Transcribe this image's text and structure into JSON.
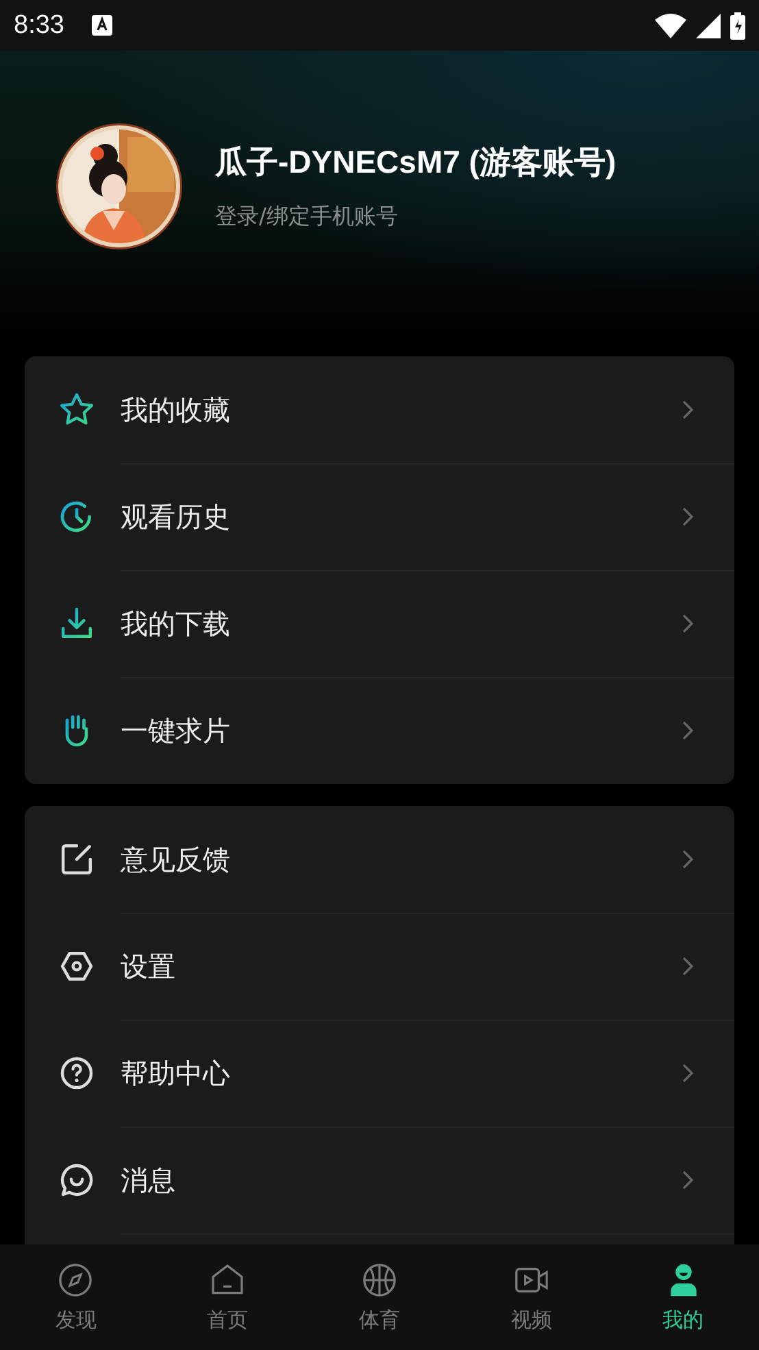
{
  "status_bar": {
    "time": "8:33"
  },
  "profile": {
    "name": "瓜子-DYNECsM7 (游客账号)",
    "subtitle": "登录/绑定手机账号"
  },
  "menu_groups": [
    {
      "items": [
        {
          "label": "我的收藏",
          "kind": "star"
        },
        {
          "label": "观看历史",
          "kind": "clock"
        },
        {
          "label": "我的下载",
          "kind": "download"
        },
        {
          "label": "一键求片",
          "kind": "hand"
        }
      ]
    },
    {
      "items": [
        {
          "label": "意见反馈",
          "kind": "edit"
        },
        {
          "label": "设置",
          "kind": "hex"
        },
        {
          "label": "帮助中心",
          "kind": "help"
        },
        {
          "label": "消息",
          "kind": "chat"
        }
      ]
    }
  ],
  "tabs": [
    {
      "label": "发现",
      "kind": "compass",
      "selected": false
    },
    {
      "label": "首页",
      "kind": "home",
      "selected": false
    },
    {
      "label": "体育",
      "kind": "ball",
      "selected": false
    },
    {
      "label": "视频",
      "kind": "video",
      "selected": false
    },
    {
      "label": "我的",
      "kind": "person",
      "selected": true
    }
  ]
}
